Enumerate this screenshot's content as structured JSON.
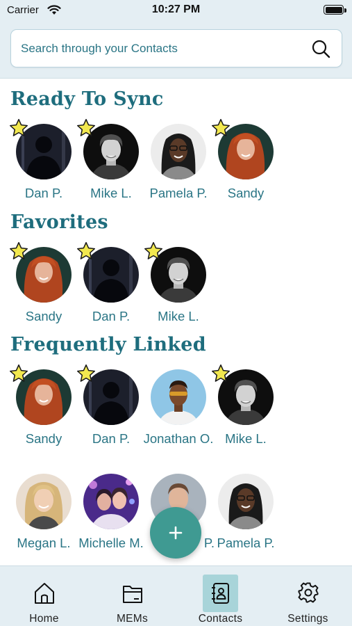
{
  "status_bar": {
    "carrier": "Carrier",
    "time": "10:27 PM"
  },
  "search": {
    "placeholder": "Search through your Contacts"
  },
  "sections": {
    "ready": {
      "title": "Ready To Sync",
      "contacts": [
        {
          "name": "Dan P.",
          "favorite": true,
          "avatar": "silhouette"
        },
        {
          "name": "Mike L.",
          "favorite": true,
          "avatar": "man-curly-bw"
        },
        {
          "name": "Pamela P.",
          "favorite": false,
          "avatar": "woman-glasses"
        },
        {
          "name": "Sandy",
          "favorite": true,
          "avatar": "woman-red-hair"
        }
      ]
    },
    "favorites": {
      "title": "Favorites",
      "contacts": [
        {
          "name": "Sandy",
          "favorite": true,
          "avatar": "woman-red-hair"
        },
        {
          "name": "Dan P.",
          "favorite": true,
          "avatar": "silhouette"
        },
        {
          "name": "Mike L.",
          "favorite": true,
          "avatar": "man-curly-bw"
        }
      ]
    },
    "frequent": {
      "title": "Frequently Linked",
      "contacts": [
        {
          "name": "Sandy",
          "favorite": true,
          "avatar": "woman-red-hair"
        },
        {
          "name": "Dan P.",
          "favorite": true,
          "avatar": "silhouette"
        },
        {
          "name": "Jonathan O.",
          "favorite": false,
          "avatar": "man-sunglasses"
        },
        {
          "name": "Mike L.",
          "favorite": true,
          "avatar": "man-curly-bw"
        },
        {
          "name": "Megan L.",
          "favorite": false,
          "avatar": "woman-blonde"
        },
        {
          "name": "Michelle M.",
          "favorite": false,
          "avatar": "women-party"
        },
        {
          "name": "P.",
          "favorite": false,
          "avatar": "man-gray"
        },
        {
          "name": "Pamela P.",
          "favorite": false,
          "avatar": "woman-glasses"
        }
      ]
    }
  },
  "fab": {
    "icon": "plus-icon"
  },
  "tabs": [
    {
      "label": "Home",
      "icon": "home-icon",
      "active": false
    },
    {
      "label": "MEMs",
      "icon": "folder-icon",
      "active": false
    },
    {
      "label": "Contacts",
      "icon": "contacts-book-icon",
      "active": true
    },
    {
      "label": "Settings",
      "icon": "gear-icon",
      "active": false
    }
  ],
  "colors": {
    "accent": "#1e6d7d",
    "header_bg": "#e4eef3",
    "fab": "#3f9a92",
    "star": "#f2e84f",
    "active_tab": "#a8d4d9"
  }
}
